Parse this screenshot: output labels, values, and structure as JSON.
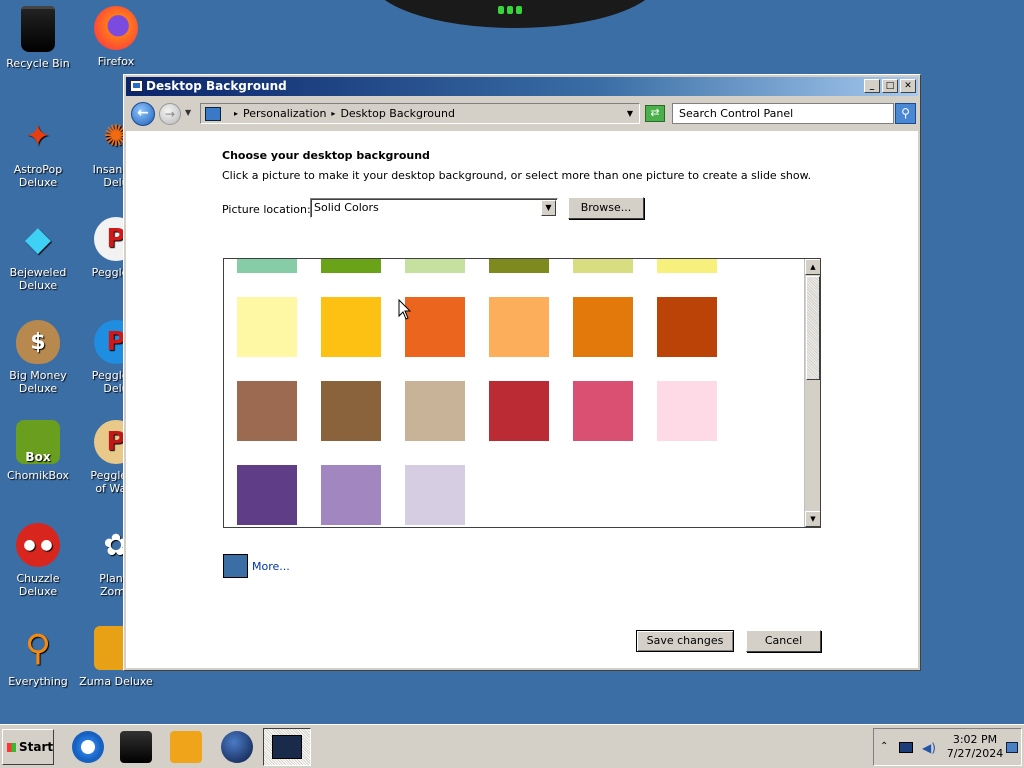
{
  "desktop": {
    "background": "#3b6ea5",
    "icons": [
      {
        "label": "Recycle Bin",
        "icon": "recycle-bin-icon"
      },
      {
        "label": "Firefox",
        "icon": "firefox-icon"
      },
      {
        "label": "AstroPop Deluxe",
        "icon": "astropop-icon"
      },
      {
        "label": "Insaniquarium Deluxe",
        "icon": "insaniquarium-icon"
      },
      {
        "label": "Bejeweled Deluxe",
        "icon": "bejeweled-icon"
      },
      {
        "label": "Peggle Deluxe",
        "icon": "peggle-icon"
      },
      {
        "label": "Big Money Deluxe",
        "icon": "big-money-icon"
      },
      {
        "label": "Peggle Nights Deluxe",
        "icon": "peggle-nights-icon"
      },
      {
        "label": "ChomikBox",
        "icon": "chomikbox-icon"
      },
      {
        "label": "Peggle World of Warcraft",
        "icon": "peggle-wow-icon"
      },
      {
        "label": "Chuzzle Deluxe",
        "icon": "chuzzle-icon"
      },
      {
        "label": "Plants vs. Zombies",
        "icon": "plants-zombies-icon"
      },
      {
        "label": "Everything",
        "icon": "everything-search-icon"
      },
      {
        "label": "Zuma Deluxe",
        "icon": "zuma-icon"
      }
    ],
    "icon_labels_visible": {
      "recycle": "Recycle Bin",
      "firefox": "Firefox",
      "astropop": "AstroPop Deluxe",
      "insaniquarium": "Insaniqu Delu",
      "bejeweled": "Bejeweled Deluxe",
      "peggle": "Peggle D",
      "bigmoney": "Big Money Deluxe",
      "peggle_nights": "Peggle N Delu",
      "chomikbox": "ChomikBox",
      "peggle_wow": "Peggle W of Warc",
      "chuzzle": "Chuzzle Deluxe",
      "plants": "Plants Zomb",
      "everything": "Everything",
      "zuma": "Zuma Deluxe"
    }
  },
  "window": {
    "title": "Desktop Background",
    "controls": {
      "minimize": "_",
      "maximize": "□",
      "close": "✕"
    },
    "address": {
      "crumb1": "Personalization",
      "crumb2": "Desktop Background"
    },
    "search": {
      "placeholder": "Search Control Panel"
    },
    "heading": "Choose your desktop background",
    "subtext": "Click a picture to make it your desktop background, or select more than one picture to create a slide show.",
    "picture_location_label": "Picture location:",
    "picture_location_value": "Solid Colors",
    "browse_label": "Browse...",
    "swatch_rows": [
      [
        "#86cca6",
        "#6aa318",
        "#c6e0a0",
        "#7f8a1e",
        "#d9dd82",
        "#f8f07c"
      ],
      [
        "#fef7a4",
        "#fdc113",
        "#eb651f",
        "#fdae5b",
        "#e4790b",
        "#bc4307"
      ],
      [
        "#9c6a51",
        "#8a623b",
        "#c8b399",
        "#bb2b33",
        "#d95072",
        "#fddae6"
      ],
      [
        "#5f3e87",
        "#a286bf",
        "#d6cde3"
      ]
    ],
    "more_color": "#3b6ea5",
    "more_label": "More...",
    "save_label": "Save changes",
    "cancel_label": "Cancel"
  },
  "taskbar": {
    "start_label": "Start",
    "clock_time": "3:02 PM",
    "clock_date": "7/27/2024"
  }
}
